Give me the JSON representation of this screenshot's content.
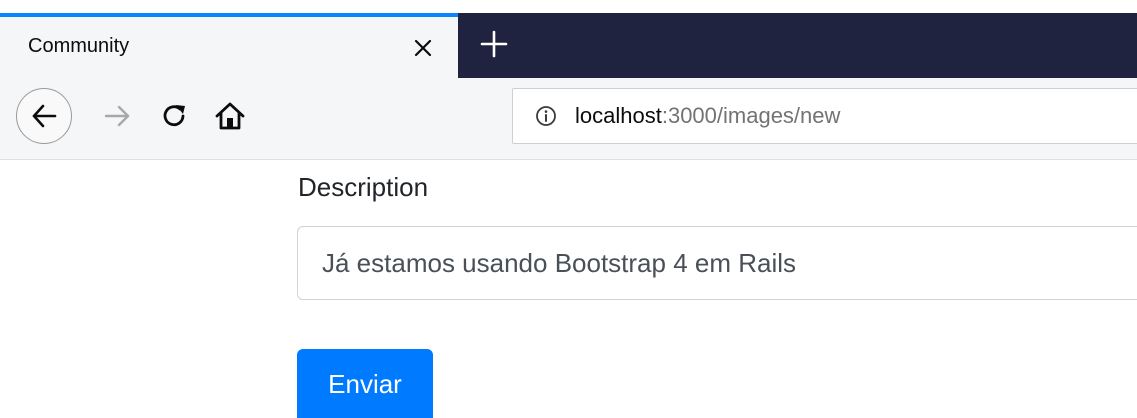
{
  "browser": {
    "tab": {
      "title": "Community"
    },
    "address": {
      "host": "localhost",
      "rest": ":3000/images/new"
    }
  },
  "form": {
    "description_label": "Description",
    "description_value": "Já estamos usando Bootstrap 4 em Rails",
    "submit_label": "Enviar"
  },
  "icons": {
    "tab_close": "close-icon",
    "new_tab": "plus-icon",
    "back": "arrow-left-icon",
    "forward": "arrow-right-icon",
    "reload": "reload-icon",
    "home": "home-icon",
    "site_info": "info-icon"
  },
  "colors": {
    "accent_tab": "#0a84ff",
    "tabstrip_dark": "#1f2340",
    "primary_button": "#007bff",
    "text": "#212529"
  }
}
